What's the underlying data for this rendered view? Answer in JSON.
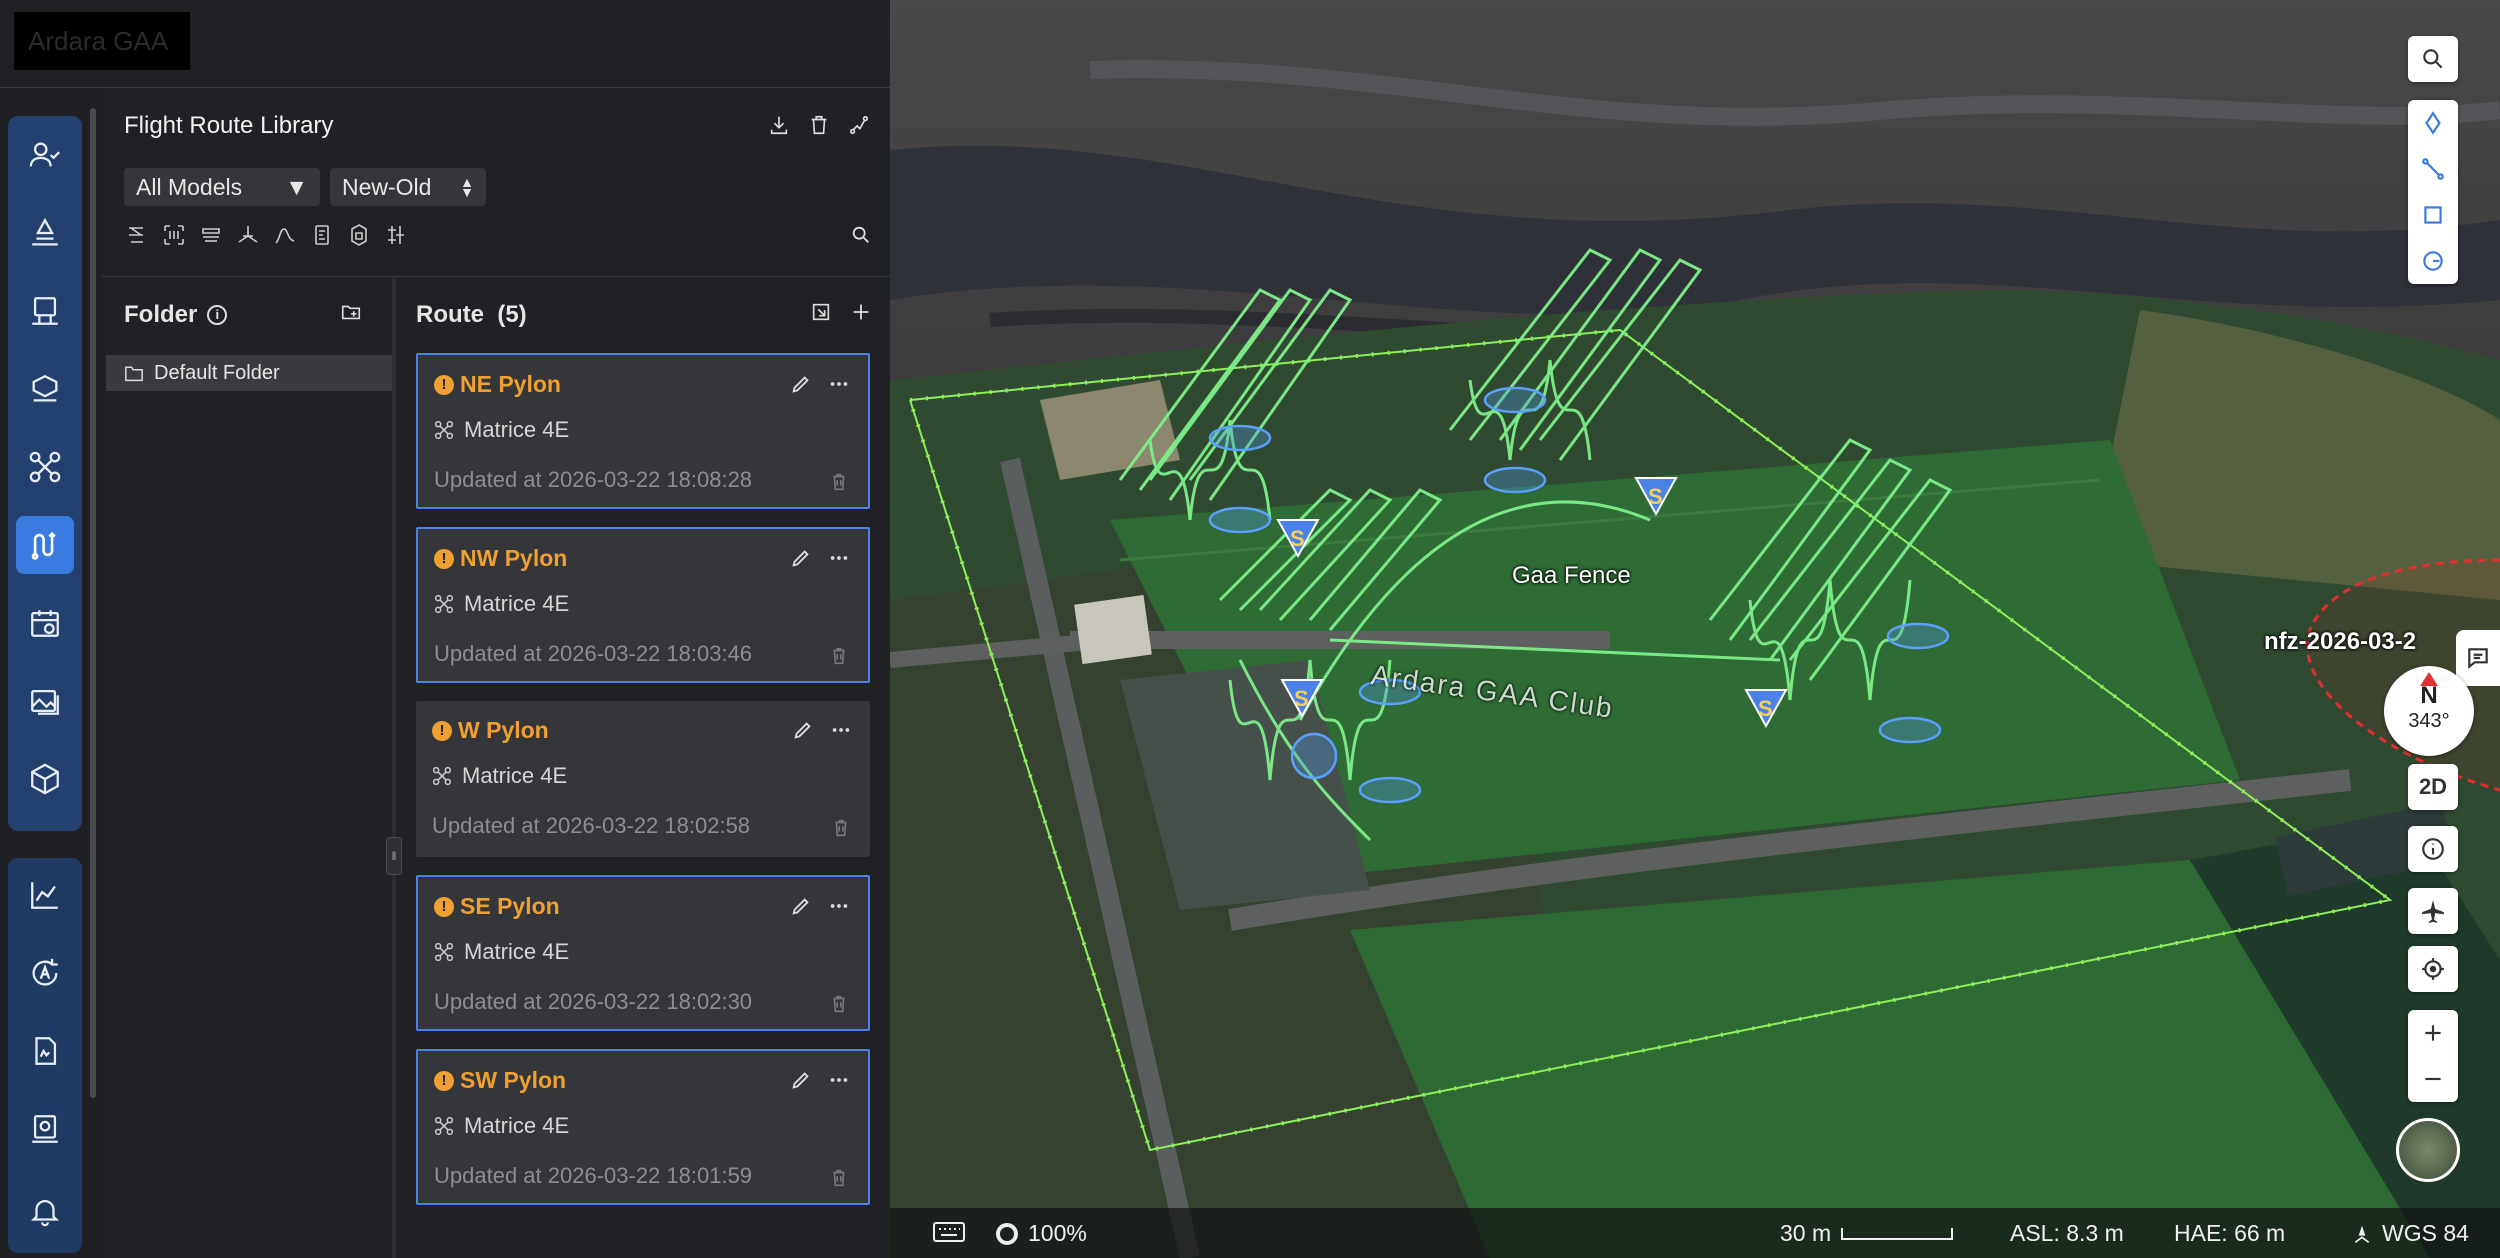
{
  "org": {
    "name": "Ardara GAA"
  },
  "library": {
    "title": "Flight Route Library",
    "model_filter": "All Models",
    "sort_order": "New-Old"
  },
  "folders": {
    "header": "Folder",
    "items": [
      {
        "label": "Default Folder"
      }
    ]
  },
  "routes": {
    "header": "Route",
    "count": "(5)",
    "items": [
      {
        "name": "NE Pylon",
        "model": "Matrice 4E",
        "updated": "Updated at 2026-03-22 18:08:28",
        "selected": true
      },
      {
        "name": "NW Pylon",
        "model": "Matrice 4E",
        "updated": "Updated at 2026-03-22 18:03:46",
        "selected": true
      },
      {
        "name": "W Pylon",
        "model": "Matrice 4E",
        "updated": "Updated at 2026-03-22 18:02:58",
        "selected": false
      },
      {
        "name": "SE Pylon",
        "model": "Matrice 4E",
        "updated": "Updated at 2026-03-22 18:02:30",
        "selected": true
      },
      {
        "name": "SW Pylon",
        "model": "Matrice 4E",
        "updated": "Updated at 2026-03-22 18:01:59",
        "selected": true
      }
    ]
  },
  "map": {
    "labels": {
      "fence": "Gaa Fence",
      "club": "Ardara GAA Club",
      "nfz": "nfz-2026-03-2"
    },
    "compass": {
      "north": "N",
      "heading": "343°"
    },
    "view_mode": "2D",
    "colors": {
      "route": "#7ef08a",
      "fence": "#8cf05a",
      "nfz": "#e03030",
      "accent": "#3a7be0",
      "warning": "#f0a030"
    }
  },
  "status": {
    "zoom": "100%",
    "scale": "30 m",
    "asl": "ASL: 8.3 m",
    "hae": "HAE: 66 m",
    "crs": "WGS 84"
  },
  "icons": {
    "rail": [
      "team-icon",
      "annotation-icon",
      "device-icon",
      "model-icon",
      "drone-health-icon",
      "flight-route-icon",
      "task-plan-icon",
      "media-icon",
      "model-3d-icon",
      "analytics-icon",
      "auto-flight-icon",
      "report-icon",
      "inspection-icon",
      "notification-icon"
    ]
  }
}
